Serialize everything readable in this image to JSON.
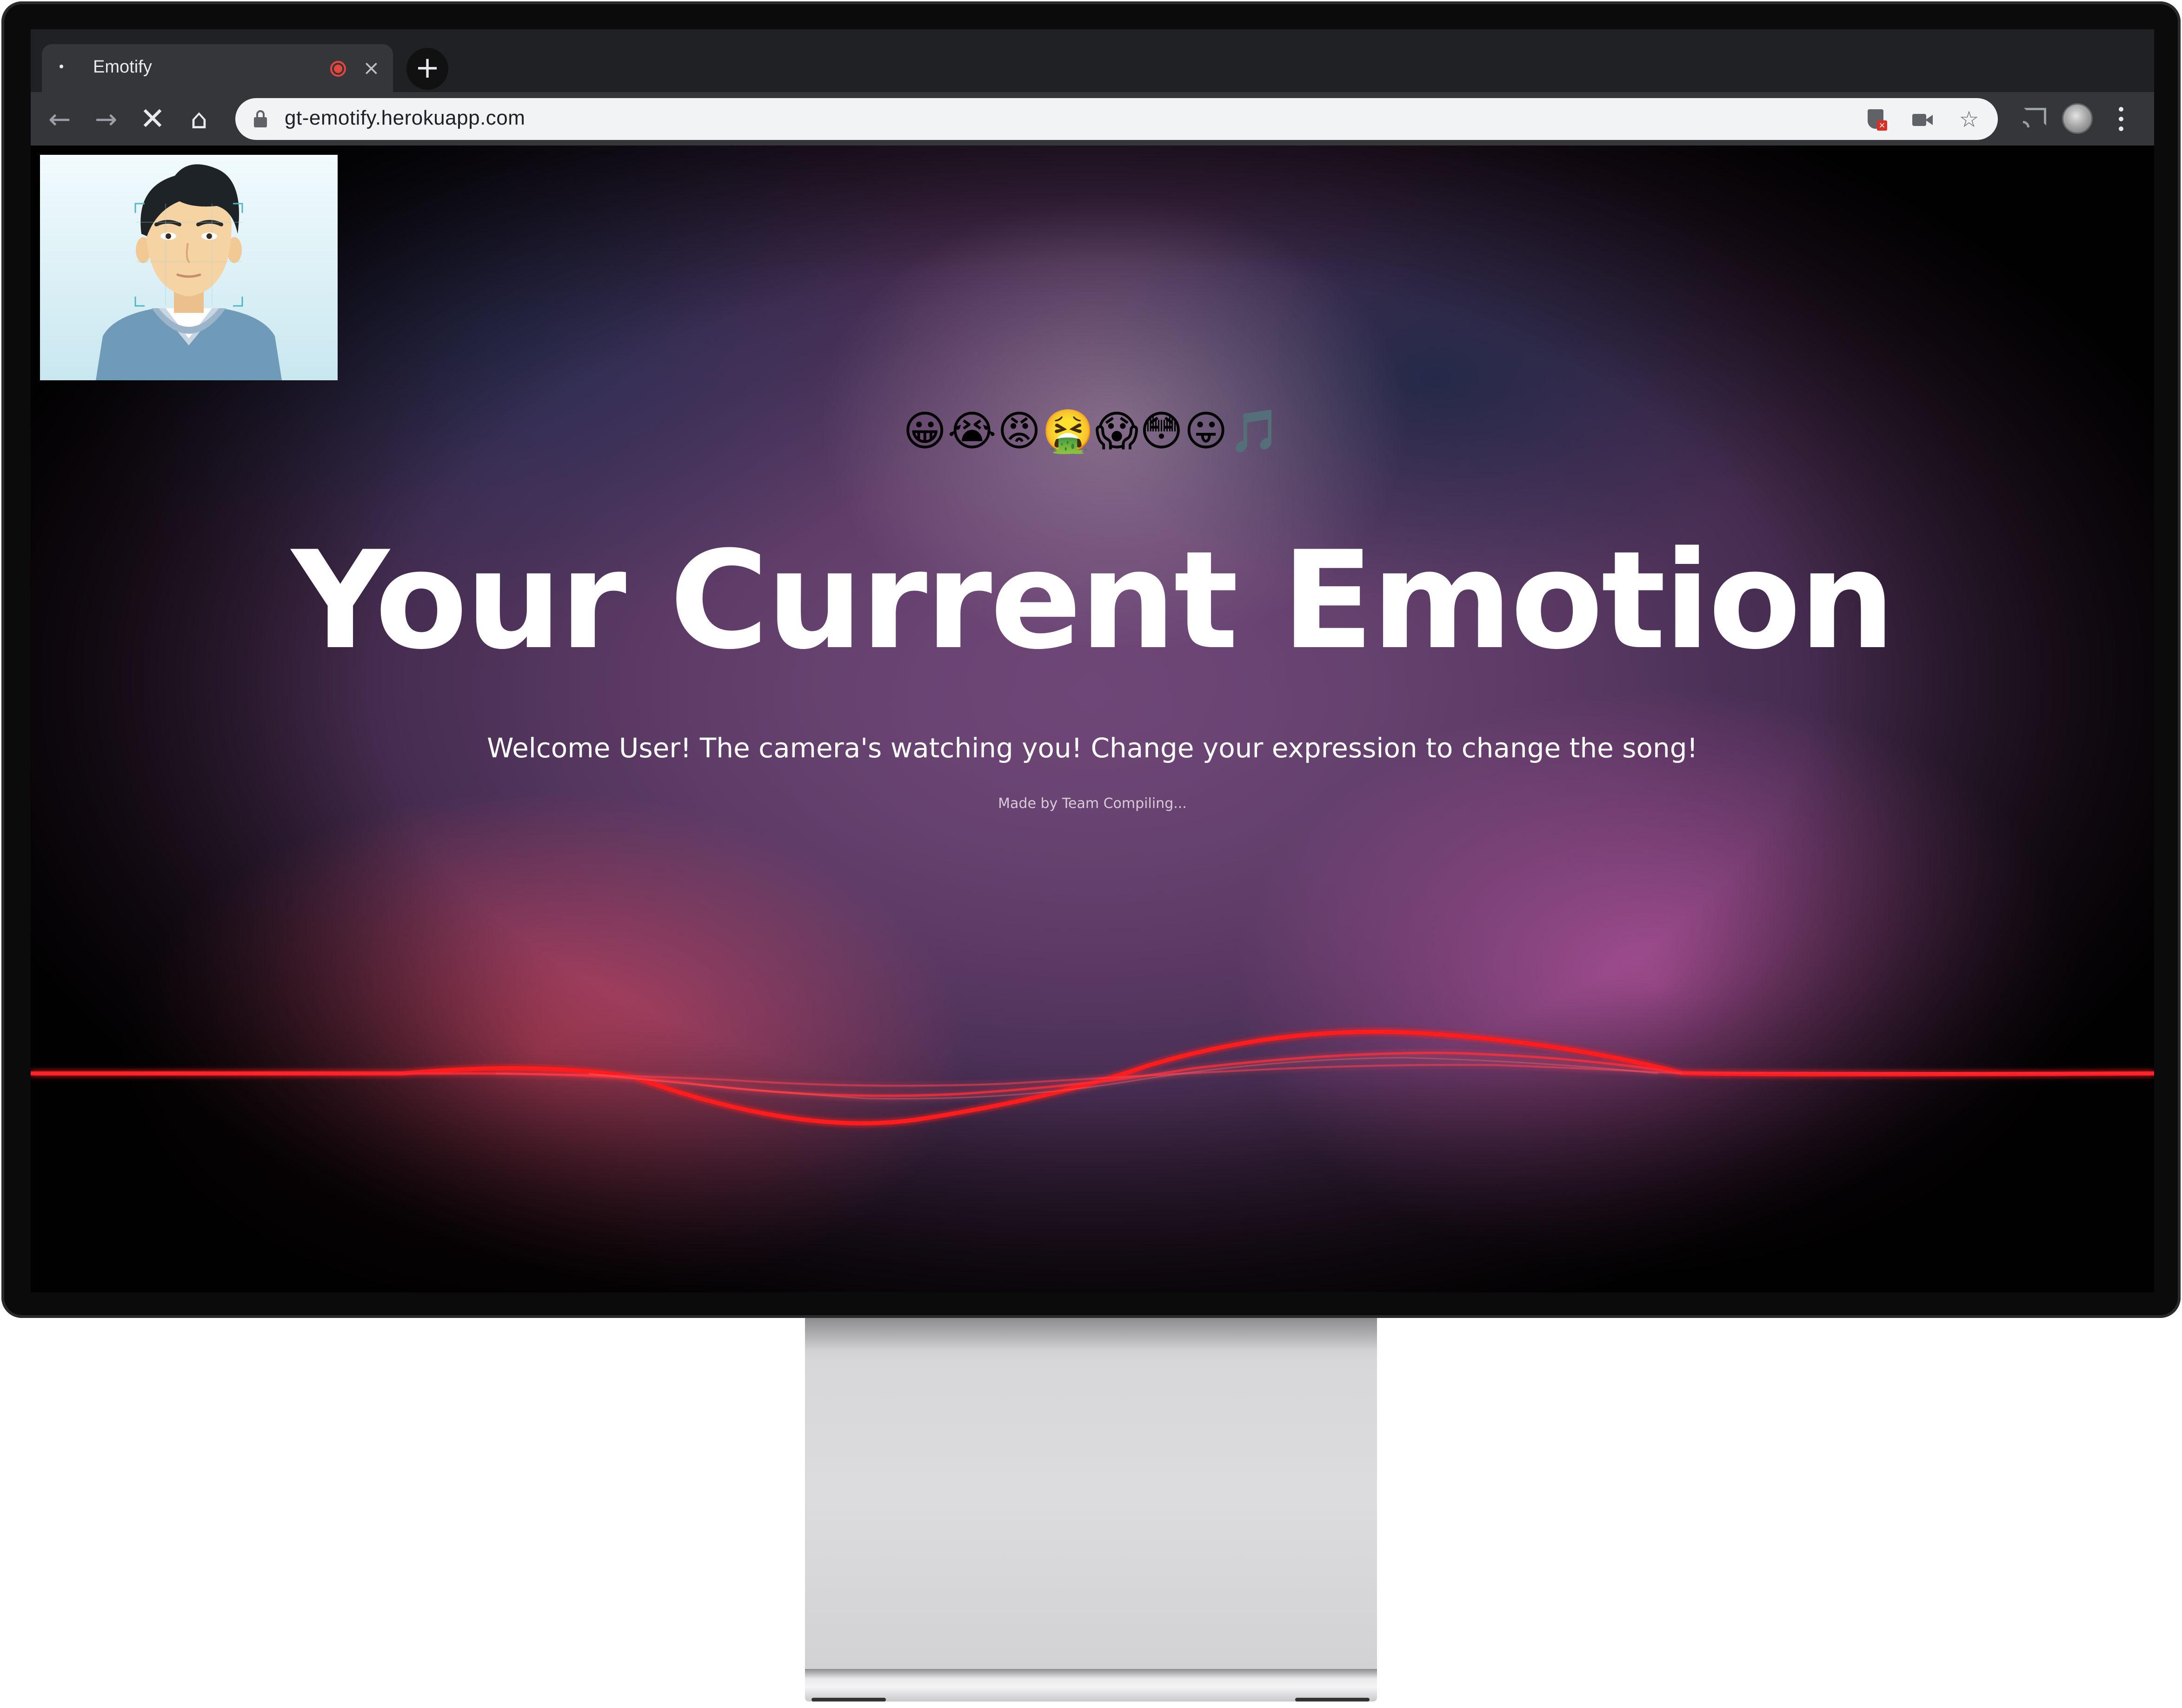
{
  "browser": {
    "tab": {
      "title": "Emotify"
    },
    "new_tab_label": "+",
    "address_bar": {
      "url": "gt-emotify.herokuapp.com"
    },
    "icons": [
      "back-icon",
      "forward-icon",
      "stop-icon",
      "home-icon",
      "lock-icon",
      "shield-blocked-icon",
      "camera-icon",
      "star-icon",
      "cast-icon",
      "profile-avatar",
      "menu-icon"
    ]
  },
  "page": {
    "emoji_row": "😀😭😡🤮😱😳😛🎵",
    "headline": "Your Current Emotion",
    "subtitle": "Welcome User! The camera's watching you! Change your expression to change the song!",
    "credit": "Made by Team Compiling..."
  },
  "colors": {
    "wave": "#ff1a1a",
    "tab_bg": "#35363a",
    "tabbar_bg": "#202124",
    "recording": "#e8453c"
  }
}
